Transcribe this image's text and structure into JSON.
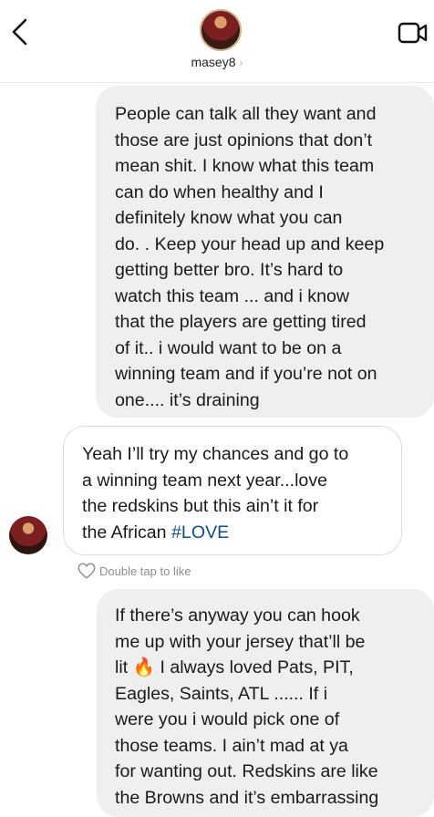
{
  "header": {
    "username": "masey8",
    "chevron": "›"
  },
  "icons": {
    "back": "chevron-left-icon",
    "video": "video-camera-icon",
    "like": "heart-outline-icon"
  },
  "messages": [
    {
      "direction": "sent",
      "text": "People can talk all they want and\nthose are just opinions that don’t\nmean shit. I know what this team\ncan do when healthy and I\ndefinitely know what you can\ndo. . Keep your head up and keep\ngetting better bro.  It’s hard to\nwatch this team ... and i know\nthat the players are getting tired\nof it..     i would want to be on a\nwinning team and if you’re not on\none.... it’s draining"
    },
    {
      "direction": "received",
      "text": "Yeah I’ll try my chances and go to\na winning team next year...love\nthe redskins but this ain’t it for\nthe African ",
      "hashtag": "#LOVE"
    },
    {
      "direction": "sent",
      "text_before_emoji": "If there’s anyway you can hook\nme up with your jersey that’ll be\nlit ",
      "emoji": "🔥",
      "text_after_emoji": " I always loved Pats, PIT,\nEagles,    Saints, ATL ......  If i\nwere you i would pick one of\nthose teams.    I ain’t mad at ya\nfor wanting out.  Redskins are like\nthe Browns and it’s embarrassing"
    }
  ],
  "like_hint": "Double tap to like",
  "colors": {
    "sent_bubble": "#efefef",
    "received_border": "#dcdcdc",
    "hashtag": "#0b4f8c",
    "muted": "#8e8e8e"
  }
}
